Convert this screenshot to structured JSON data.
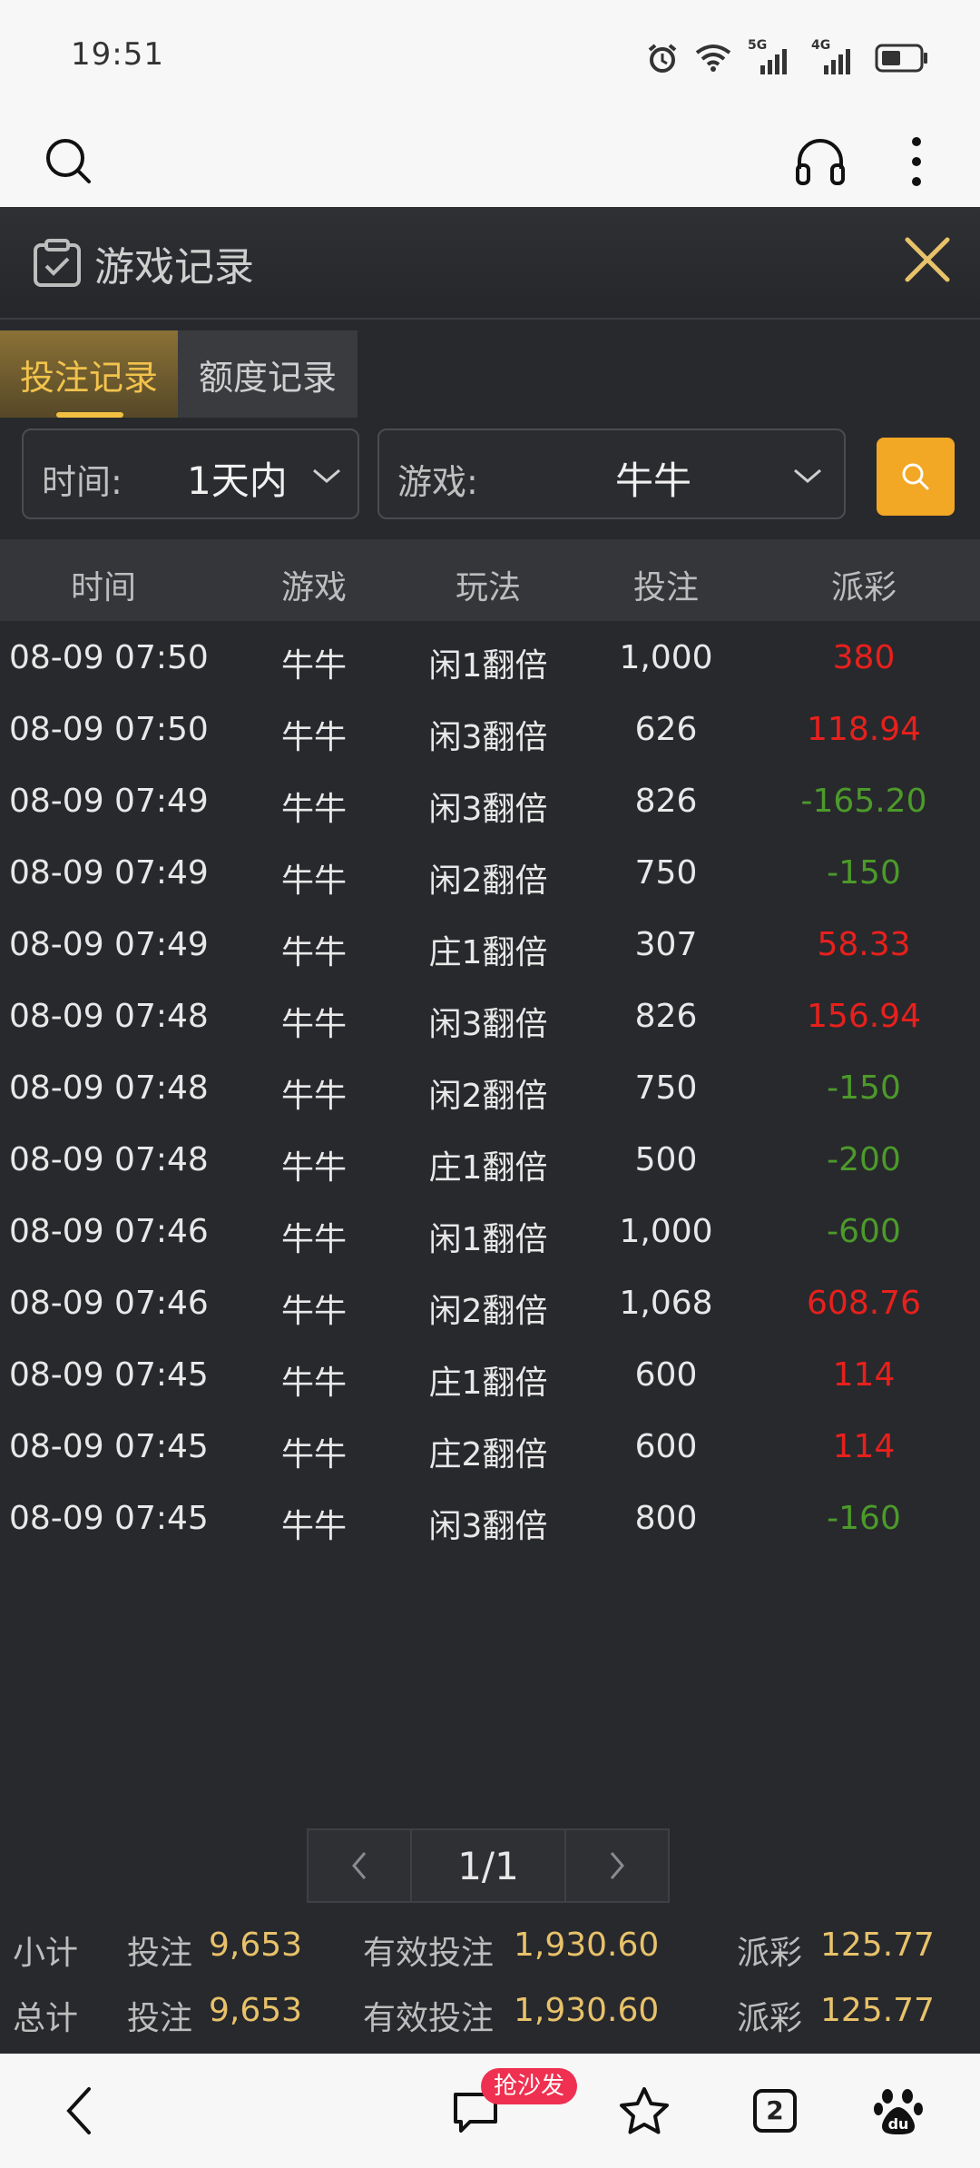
{
  "status": {
    "time": "19:51",
    "net1": "5G",
    "net2": "4G"
  },
  "modal": {
    "title": "游戏记录",
    "tabs": [
      {
        "label": "投注记录",
        "active": true
      },
      {
        "label": "额度记录",
        "active": false
      }
    ],
    "filters": {
      "time_label": "时间:",
      "time_value": "1天内",
      "game_label": "游戏:",
      "game_value": "牛牛"
    },
    "table": {
      "headers": [
        "时间",
        "游戏",
        "玩法",
        "投注",
        "派彩"
      ],
      "rows": [
        {
          "time": "08-09 07:50",
          "game": "牛牛",
          "play": "闲1翻倍",
          "bet": "1,000",
          "payout": "380",
          "sign": "pos"
        },
        {
          "time": "08-09 07:50",
          "game": "牛牛",
          "play": "闲3翻倍",
          "bet": "626",
          "payout": "118.94",
          "sign": "pos"
        },
        {
          "time": "08-09 07:49",
          "game": "牛牛",
          "play": "闲3翻倍",
          "bet": "826",
          "payout": "-165.20",
          "sign": "neg"
        },
        {
          "time": "08-09 07:49",
          "game": "牛牛",
          "play": "闲2翻倍",
          "bet": "750",
          "payout": "-150",
          "sign": "neg"
        },
        {
          "time": "08-09 07:49",
          "game": "牛牛",
          "play": "庄1翻倍",
          "bet": "307",
          "payout": "58.33",
          "sign": "pos"
        },
        {
          "time": "08-09 07:48",
          "game": "牛牛",
          "play": "闲3翻倍",
          "bet": "826",
          "payout": "156.94",
          "sign": "pos"
        },
        {
          "time": "08-09 07:48",
          "game": "牛牛",
          "play": "闲2翻倍",
          "bet": "750",
          "payout": "-150",
          "sign": "neg"
        },
        {
          "time": "08-09 07:48",
          "game": "牛牛",
          "play": "庄1翻倍",
          "bet": "500",
          "payout": "-200",
          "sign": "neg"
        },
        {
          "time": "08-09 07:46",
          "game": "牛牛",
          "play": "闲1翻倍",
          "bet": "1,000",
          "payout": "-600",
          "sign": "neg"
        },
        {
          "time": "08-09 07:46",
          "game": "牛牛",
          "play": "闲2翻倍",
          "bet": "1,068",
          "payout": "608.76",
          "sign": "pos"
        },
        {
          "time": "08-09 07:45",
          "game": "牛牛",
          "play": "庄1翻倍",
          "bet": "600",
          "payout": "114",
          "sign": "pos"
        },
        {
          "time": "08-09 07:45",
          "game": "牛牛",
          "play": "庄2翻倍",
          "bet": "600",
          "payout": "114",
          "sign": "pos"
        },
        {
          "time": "08-09 07:45",
          "game": "牛牛",
          "play": "闲3翻倍",
          "bet": "800",
          "payout": "-160",
          "sign": "neg"
        }
      ]
    },
    "pager": {
      "label": "1/1"
    },
    "subtotal": {
      "label": "小计",
      "bet_label": "投注",
      "bet": "9,653",
      "valid_label": "有效投注",
      "valid": "1,930.60",
      "pay_label": "派彩",
      "pay": "125.77"
    },
    "total": {
      "label": "总计",
      "bet_label": "投注",
      "bet": "9,653",
      "valid_label": "有效投注",
      "valid": "1,930.60",
      "pay_label": "派彩",
      "pay": "125.77"
    }
  },
  "bottom_nav": {
    "badge": "抢沙发",
    "tab_count": "2"
  },
  "colors": {
    "accent": "#f2a725",
    "positive": "#e8201c",
    "negative": "#4c9a2a",
    "summary_value": "#e8c26a"
  }
}
